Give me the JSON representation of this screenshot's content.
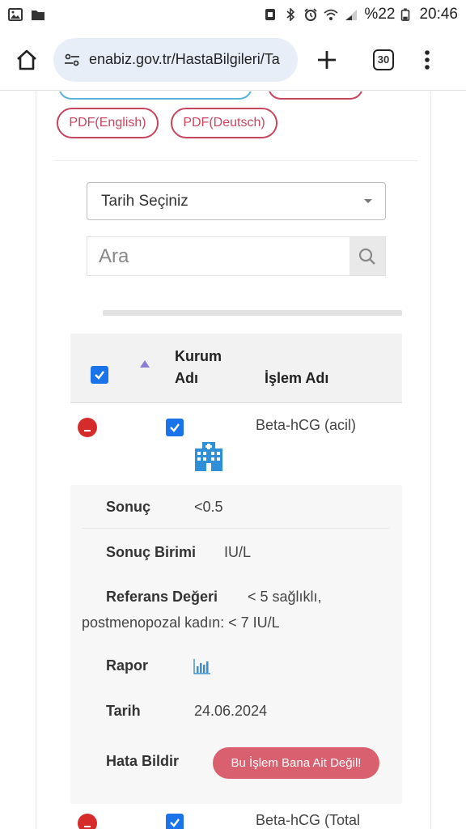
{
  "status_bar": {
    "battery": "%22",
    "time": "20:46"
  },
  "browser": {
    "url": "enabiz.gov.tr/HastaBilgileri/Ta",
    "tab_count": "30"
  },
  "export_buttons": {
    "pdf_english": "PDF(English)",
    "pdf_deutsch": "PDF(Deutsch)"
  },
  "filters": {
    "date_select": "Tarih Seçiniz",
    "search_placeholder": "Ara"
  },
  "table": {
    "headers": {
      "institution_line1": "Kurum",
      "institution_line2": "Adı",
      "procedure": "İşlem Adı"
    },
    "rows": [
      {
        "procedure": "Beta-hCG (acil)",
        "details": {
          "result_label": "Sonuç",
          "result_value": "<0.5",
          "unit_label": "Sonuç Birimi",
          "unit_value": "IU/L",
          "reference_label": "Referans Değeri",
          "reference_value_line1": "< 5 sağlıklı,",
          "reference_value_line2": "postmenopozal kadın: < 7 IU/L",
          "report_label": "Rapor",
          "date_label": "Tarih",
          "date_value": "24.06.2024",
          "error_label": "Hata Bildir",
          "error_button": "Bu İşlem Bana Ait Değil!"
        }
      },
      {
        "procedure": "Beta-hCG (Total"
      }
    ]
  },
  "colors": {
    "pill_red": "#c9455e",
    "pill_blue": "#5ab2d8",
    "checkbox_blue": "#1a73e8",
    "collapse_red": "#d52b2b",
    "hospital_icon_blue": "#2f8fd8",
    "report_button": "#d9606e"
  }
}
